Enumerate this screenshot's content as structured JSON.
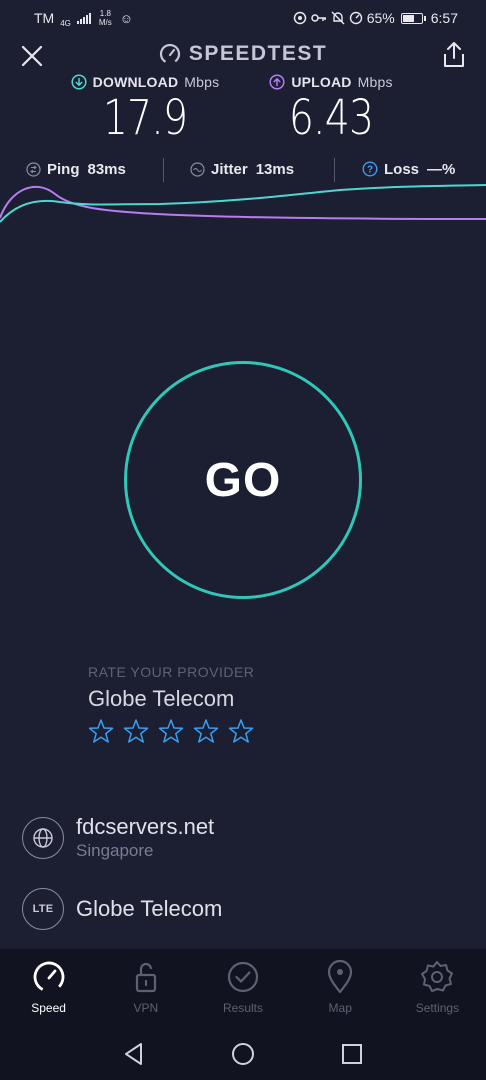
{
  "status_bar": {
    "carrier": "TM",
    "network_type": "4G",
    "data_speed_value": "1.8",
    "data_speed_unit": "M/s",
    "battery": "65%",
    "battery_level": 0.65,
    "time": "6:57"
  },
  "header": {
    "title": "SPEEDTEST"
  },
  "download": {
    "label": "DOWNLOAD",
    "unit": "Mbps",
    "value": "17.9"
  },
  "upload": {
    "label": "UPLOAD",
    "unit": "Mbps",
    "value": "6.43"
  },
  "stats": {
    "ping_label": "Ping",
    "ping_value": "83ms",
    "jitter_label": "Jitter",
    "jitter_value": "13ms",
    "loss_label": "Loss",
    "loss_value": "—%"
  },
  "colors": {
    "background": "#1c1e31",
    "download_accent": "#4fd6d0",
    "upload_accent": "#b77cf0",
    "go_ring": "#2fc8b8",
    "star": "#3a9ff0",
    "tab_bar": "#121320"
  },
  "go_button": {
    "label": "GO"
  },
  "rate": {
    "title": "RATE YOUR PROVIDER",
    "provider": "Globe Telecom",
    "stars": 5
  },
  "server": {
    "name": "fdcservers.net",
    "location": "Singapore",
    "icon": "globe-icon"
  },
  "carrier": {
    "name": "Globe Telecom",
    "icon_text": "LTE"
  },
  "tabs": [
    {
      "label": "Speed",
      "icon": "speedometer-icon",
      "active": true
    },
    {
      "label": "VPN",
      "icon": "lock-icon",
      "active": false
    },
    {
      "label": "Results",
      "icon": "check-circle-icon",
      "active": false
    },
    {
      "label": "Map",
      "icon": "map-pin-icon",
      "active": false
    },
    {
      "label": "Settings",
      "icon": "gear-icon",
      "active": false
    }
  ]
}
